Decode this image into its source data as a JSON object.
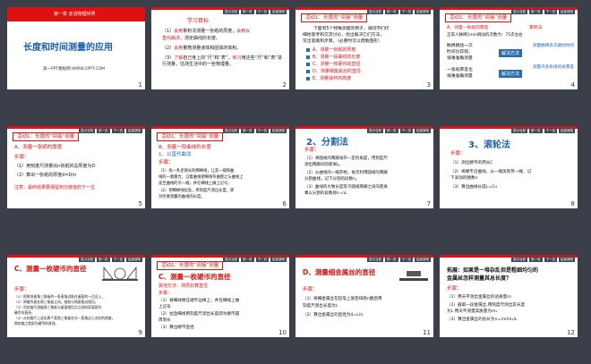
{
  "toolbar": [
    "显示当前",
    "前一页",
    "下一页",
    "结束放映"
  ],
  "slides": [
    {
      "num": "1",
      "chapter": "第一章 走进物理世界",
      "title": "长度和时间测量的应用",
      "footer": "第一PPT模板网-WWW.1PPT.COM"
    },
    {
      "num": "2",
      "heading": "学习目标",
      "l1a": "（1）",
      "l1b": "会用",
      "l1c": "累积法测量一张纸的厚度，",
      "l1d": "会用",
      "l1e": "以",
      "l1f": "直代曲法，",
      "l1g": "测定曲线的长度。",
      "l2a": "（2）",
      "l2b": "会用",
      "l2c": "量筒测量液体和固体的体积。",
      "l3a": "（3）",
      "l3b": "了解",
      "l3c": "自己身上的“尺”和“表”，",
      "l3d": "练习",
      "l3e": "用这些“尺”和“表”进行测量，估测生活中的一些物理量。"
    },
    {
      "num": "3",
      "box": "活动1：长度的“间接”测量",
      "p1": "下面有5个特殊测量的例子，请同学们仔",
      "p2": "细地思考和交流讨论，找出解决它们方法，",
      "p3": "写出思路和步骤。（必要时可以借助图形）",
      "items": [
        "A、测量一张纸的厚度",
        "B、测量一段曲线的长度",
        "C、测量一枚硬币的直径",
        "D、测量细金属丝的直径",
        "E、测量操杆的高度"
      ]
    },
    {
      "num": "4",
      "box": "活动1：长度的“间接”测量",
      "a1": "A、测量一张纸的厚度",
      "a2": "累积法",
      "a3": "正常人脉搏1min跳动的次数为：75次左右",
      "q1": "脉搏跳动一次",
      "q2": "时间比较短，",
      "q3": "很难准确测量",
      "b1": "解决方法",
      "b2": "测量脉搏多次跳动时间",
      "q4": "一张纸厚度也",
      "q5": "很难准确测量",
      "b3": "解决方法",
      "b4": "测量许多张纸的总厚度"
    },
    {
      "num": "5",
      "box": "活动1：长度的“间接”测量",
      "a": "A、测量一张纸的厚度",
      "s": "步骤：",
      "s1": "（1）用刻度尺测量出n张纸的总厚度为D",
      "s2": "（2）算出一张纸的厚度d=D/n",
      "note": "注意：最终结果要保留到分度值的下一位"
    },
    {
      "num": "6",
      "box": "活动1：长度的“间接”测量",
      "a": "B、测量一段曲线的长度",
      "m": "1、以直代曲法",
      "s": "步骤：",
      "s1": "（1）找一条足够长的细棉线，让其一端和曲",
      "s2": "线的一端重合，沿着曲线把细线弯曲使之与曲线上",
      "s3": "直至曲线的另一端，并在细线上做上记号。",
      "s4": "（2）把细棉线拉直，用刻度尺测出长度，即",
      "s5": "为所要测量的曲线的长度。"
    },
    {
      "num": "7",
      "title": "2、分割法",
      "s": "步骤：",
      "s1": "（1）将圆规的两脚张开一定的角度，用刻度尺",
      "s2": "测出两脚间的距离L。",
      "s3": "（2）从曲线的一端开始，依次利用圆规的两脚",
      "s4": "分割曲线，记下分割的段数n。",
      "s5": "（3）曲线的大致长度等于圆规两脚之间的距离",
      "s6": "乘以分割的段数即s=nL"
    },
    {
      "num": "8",
      "title": "3、滚轮法",
      "s": "步骤：",
      "s1": "（1）测出硬币的周长C",
      "s2": "（2）将硬币沿曲线，从一端滚到另一端，记",
      "s3": "下滚动的圈数n",
      "s4": "（3）算出曲线长度L=Cn"
    },
    {
      "num": "9",
      "title": "C、测量一枚硬币的直径",
      "s": "步骤：",
      "s1": "（1）把两块直角三角板的一条直角边贴在桌面的一边沿上，",
      "s2": "（2）将硬币放在两三角板之间，使其与两直角边相切，",
      "s3": "（3）用刻度尺测量两三角板与桌面相切点之间的距离即为",
      "s4": "硬币的直径。",
      "s5": "（4）从刻度尺上读出两个直角三角板在另一直角边上对应的刻度，",
      "s6": "两刻度之差即为硬币的直径。"
    },
    {
      "num": "10",
      "box": "活动1：长度的“间接”测量",
      "title": "C、测量一枚硬币的直径",
      "other": "其他方法：测周长算直径",
      "s": "步骤：",
      "s1": "（1）将细线缠在硬币边缘上，并在细线上做",
      "s2": "上记号",
      "s3": "（2）拉直细线用刻度尺测出长度即为硬币圆",
      "s4": "周周长",
      "s5": "（3）算出硬币直径"
    },
    {
      "num": "11",
      "title": "D、测量细金属丝的直径",
      "s": "步骤：",
      "s1": "（1）将细金属丝在铅笔上紧密排绕n圈后用",
      "s2": "刻度尺测出长度为L",
      "s3": "（2）算出金属丝的直径为d=L/n"
    },
    {
      "num": "12",
      "t1": "拓展：如果是一堆杂乱但是粗细均匀的",
      "t2": "金属丝怎样测量其总长度？",
      "s": "步骤：",
      "s1": "（1）用天平测出金属丝的总质量m",
      "s2": "（2）截取一段金属丝,用刻度尺测出其长度",
      "s3": "为L 用天平测量其质量为m₁",
      "s4": "（3）算出金属丝的总长为n=(m/m₁)L"
    }
  ]
}
